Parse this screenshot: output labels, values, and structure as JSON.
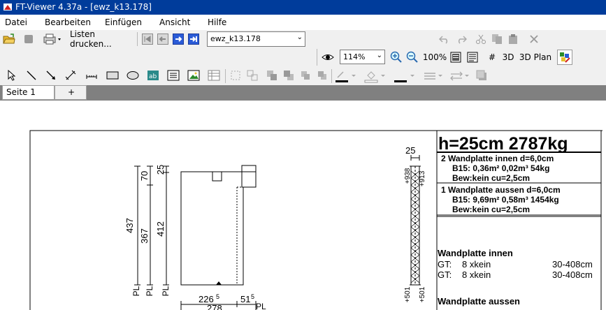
{
  "window": {
    "title": "FT-Viewer 4.37a - [ewz_k13.178]"
  },
  "menu": [
    "Datei",
    "Bearbeiten",
    "Einfügen",
    "Ansicht",
    "Hilfe"
  ],
  "toolbar": {
    "print_lists_label": "Listen drucken...",
    "file_combo_value": "ewz_k13.178",
    "zoom_value": "114%",
    "zoom_100_label": "100%",
    "hash_label": "#",
    "view_3d_label": "3D",
    "view_3d_plan_label": "3D Plan"
  },
  "tabs": {
    "page1": "Seite 1",
    "add": "+"
  },
  "drawing": {
    "header": "h=25cm 2787kg",
    "item2": {
      "line1": "2  Wandplatte innen d=6,0cm",
      "line2": "B15: 0,36m² 0,02m³ 54kg",
      "line3": "Bew:kein cu=2,5cm"
    },
    "item1": {
      "line1": "1  Wandplatte aussen d=6,0cm",
      "line2": "B15: 9,69m² 0,58m³ 1454kg",
      "line3": "Bew:kein cu=2,5cm"
    },
    "sec_inner": {
      "title": "Wandplatte innen",
      "rows": [
        {
          "gt": "GT:",
          "val": "8 xkein",
          "range": "30-408cm"
        },
        {
          "gt": "GT:",
          "val": "8 xkein",
          "range": "30-408cm"
        }
      ]
    },
    "sec_outer": {
      "title": "Wandplatte aussen"
    },
    "dims": {
      "d437": "437",
      "d367": "367",
      "d412": "412",
      "d70": "70",
      "d25": "25",
      "pl": "PL",
      "w226": "226",
      "w226sup": "5",
      "w51": "51",
      "w51sup": "5",
      "w278": "278",
      "top25": "25",
      "s938": "+938",
      "s913": "+913",
      "s501a": "+501",
      "s501b": "+501"
    }
  }
}
